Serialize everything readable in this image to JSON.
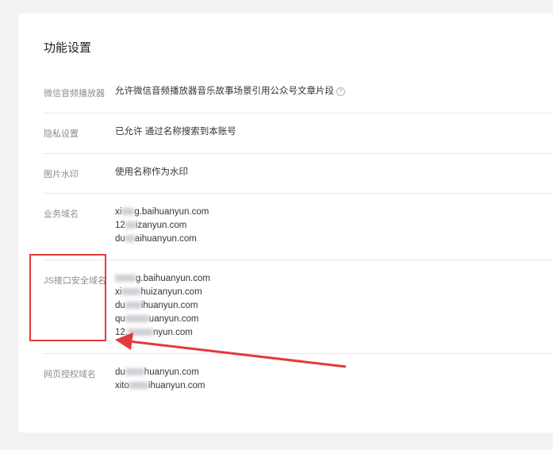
{
  "section_title": "功能设置",
  "rows": {
    "player": {
      "label": "微信音频播放器",
      "value": "允许微信音频播放器音乐故事场景引用公众号文章片段",
      "help": "?"
    },
    "privacy": {
      "label": "隐私设置",
      "value": "已允许 通过名称搜索到本账号"
    },
    "watermark": {
      "label": "图片水印",
      "value": "使用名称作为水印"
    },
    "business_domain": {
      "label": "业务域名",
      "domains": [
        {
          "prefix": "xi",
          "suffix": "g.baihuanyun.com"
        },
        {
          "prefix": "12",
          "suffix": "izanyun.com"
        },
        {
          "prefix": "du",
          "suffix": "aihuanyun.com"
        }
      ]
    },
    "js_domain": {
      "label": "JS接口安全域名",
      "domains": [
        {
          "prefix": "",
          "suffix": "g.baihuanyun.com"
        },
        {
          "prefix": "xi",
          "suffix": "huizanyun.com"
        },
        {
          "prefix": "du",
          "suffix": "ihuanyun.com"
        },
        {
          "prefix": "qu",
          "suffix": "uanyun.com"
        },
        {
          "prefix": "12.",
          "suffix": "nyun.com"
        }
      ]
    },
    "web_auth_domain": {
      "label": "网页授权域名",
      "domains": [
        {
          "prefix": "du",
          "suffix": "huanyun.com"
        },
        {
          "prefix": "xito",
          "suffix": "ihuanyun.com"
        }
      ]
    }
  },
  "colors": {
    "annotation": "#e23a3a"
  }
}
